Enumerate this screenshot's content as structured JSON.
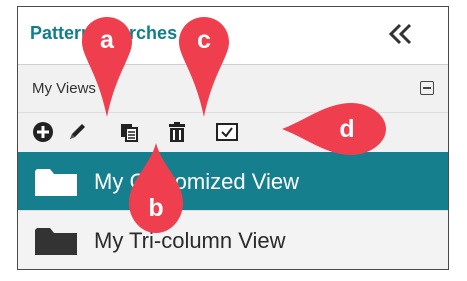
{
  "panel": {
    "title": "Pattern Searches",
    "collapse_icon": "double-chevron-left-icon"
  },
  "section": {
    "label": "My Views",
    "collapse_icon": "minus-box-icon"
  },
  "toolbar": {
    "icons": [
      "add-icon",
      "edit-icon",
      "copy-icon",
      "delete-icon",
      "checkbox-icon"
    ]
  },
  "views": [
    {
      "label": "My Customized View",
      "selected": true
    },
    {
      "label": "My Tri-column View",
      "selected": false
    }
  ],
  "callouts": {
    "a": "a",
    "b": "b",
    "c": "c",
    "d": "d"
  },
  "colors": {
    "accent": "#167f8d",
    "callout": "#ef3f4f"
  }
}
